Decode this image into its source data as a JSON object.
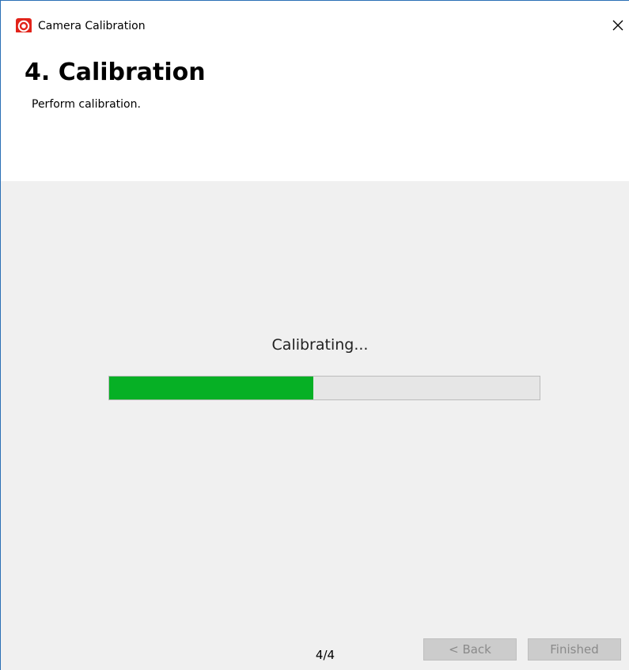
{
  "window": {
    "title": "Camera Calibration",
    "app_icon": "camera-calibration-icon",
    "close_icon": "close-icon"
  },
  "header": {
    "step_title": "4. Calibration",
    "description": "Perform calibration."
  },
  "content": {
    "status_text": "Calibrating...",
    "progress": {
      "value_percent": 47.5,
      "fill_color": "#06b025",
      "track_color": "#e6e6e6"
    }
  },
  "footer": {
    "page_indicator": "4/4",
    "back_label": "< Back",
    "finished_label": "Finished",
    "back_enabled": false,
    "finished_enabled": false
  },
  "colors": {
    "accent": "#e2231a",
    "content_background": "#f0f0f0",
    "disabled_button": "#cccccc",
    "disabled_text": "#8a8a8a"
  }
}
